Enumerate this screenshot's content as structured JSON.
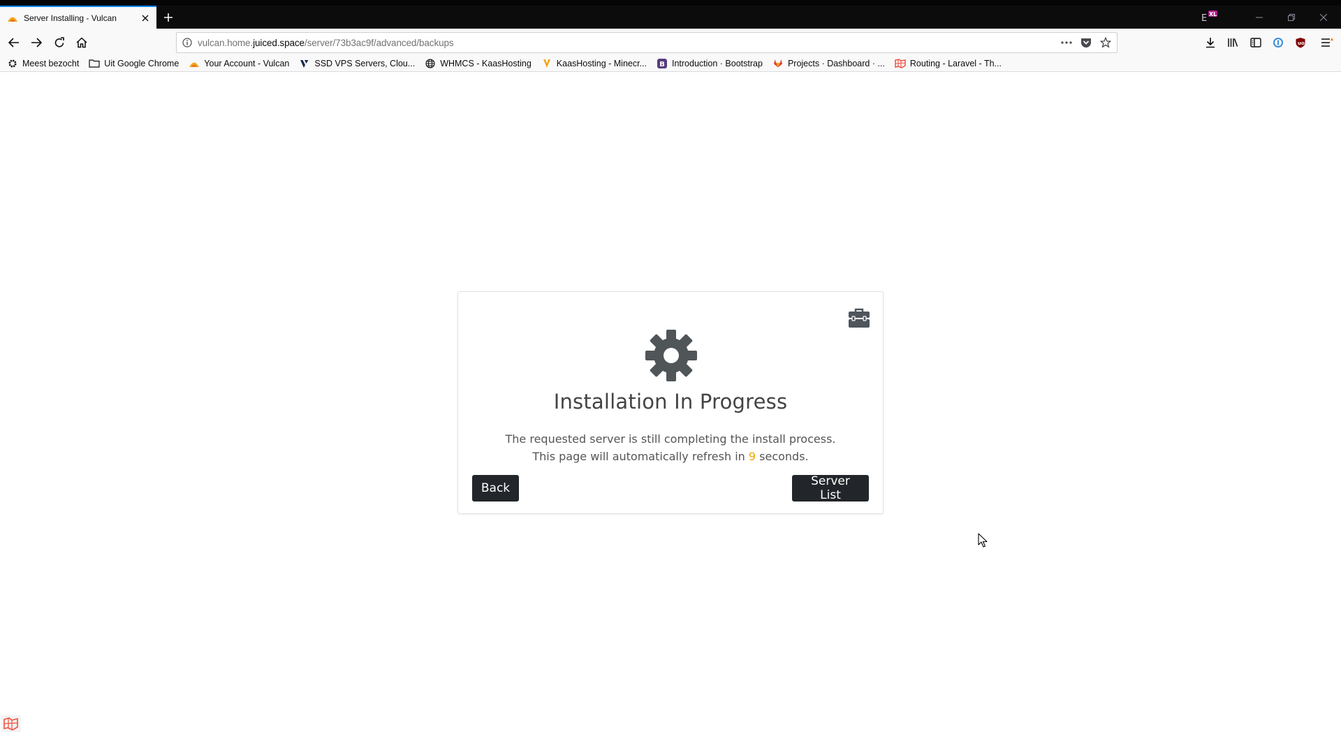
{
  "window": {
    "tab_title": "Server Installing - Vulcan"
  },
  "navbar": {
    "url_host_prefix": "vulcan.home.",
    "url_host_domain": "juiced.space",
    "url_path": "/server/73b3ac9f/advanced/backups"
  },
  "bookmarks": [
    {
      "label": "Meest bezocht",
      "icon": "gear-icon"
    },
    {
      "label": "Uit Google Chrome",
      "icon": "folder-icon"
    },
    {
      "label": "Your Account - Vulcan",
      "icon": "vulcan-favicon"
    },
    {
      "label": "SSD VPS Servers, Clou...",
      "icon": "vultr-favicon"
    },
    {
      "label": "WHMCS - KaasHosting",
      "icon": "globe-icon"
    },
    {
      "label": "KaasHosting - Minecr...",
      "icon": "kaashosting-favicon"
    },
    {
      "label": "Introduction · Bootstrap",
      "icon": "bootstrap-favicon"
    },
    {
      "label": "Projects · Dashboard · ...",
      "icon": "gitlab-favicon"
    },
    {
      "label": "Routing - Laravel - Th...",
      "icon": "laravel-favicon"
    }
  ],
  "card": {
    "title": "Installation In Progress",
    "line1": "The requested server is still completing the install process.",
    "line2_prefix": "This page will automatically refresh in ",
    "countdown": "9",
    "line2_suffix": " seconds.",
    "back_label": "Back",
    "server_list_label": "Server List"
  },
  "colors": {
    "countdown": "#f0a500",
    "button_bg": "#22262a",
    "tab_accent": "#0a84ff"
  }
}
